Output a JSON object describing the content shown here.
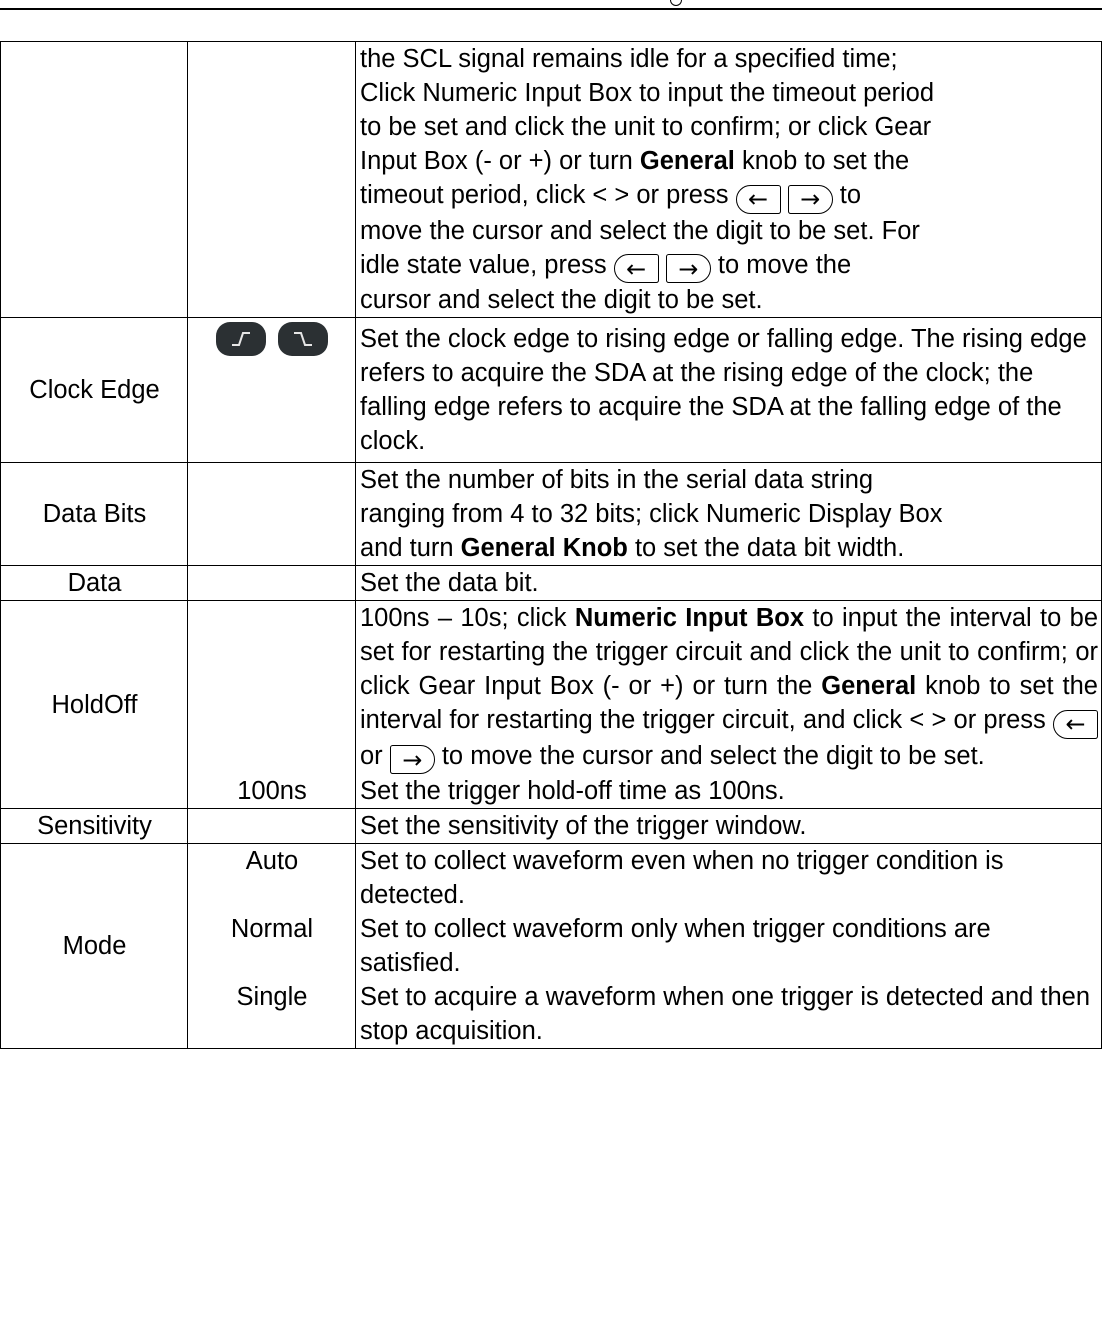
{
  "header": {},
  "rows": {
    "timeout": {
      "lines": [
        "the SCL signal remains idle for a specified time;",
        "Click Numeric Input Box to input the timeout period",
        "to be set and click the unit to confirm; or click Gear"
      ],
      "l4a": "Input Box (- or +) or turn ",
      "l4b": "General",
      "l4c": " knob to set the",
      "l5a": "timeout period, click < > or press ",
      "l5b": " to",
      "l6": "move the cursor and select the digit to be set. For",
      "l7a": "idle state value, press ",
      "l7b": " to move the",
      "l8": "cursor and select the digit to be set."
    },
    "clock_edge": {
      "param": "Clock Edge",
      "icons": [
        "rising-edge-icon",
        "falling-edge-icon"
      ],
      "desc": "Set the clock edge to rising edge or falling edge. The rising edge refers to acquire the SDA at the rising edge of the clock; the falling edge refers to acquire the SDA at the falling edge of the clock."
    },
    "data_bits": {
      "param": "Data Bits",
      "l1": "Set the number of bits in the serial data string",
      "l2": "ranging from 4 to 32 bits; click Numeric Display Box",
      "l3a": "and turn ",
      "l3b": "General Knob",
      "l3c": " to set the data bit width."
    },
    "data": {
      "param": "Data",
      "desc": "Set the data bit."
    },
    "holdoff": {
      "param": "HoldOff",
      "a1": "100ns – 10s; click ",
      "a2": "Numeric Input Box",
      "a3": " to input the interval to be set for restarting the trigger circuit and click the unit to confirm; or click Gear Input Box (- or +) or turn the ",
      "a4": "General",
      "a5": " knob to set the interval for restarting the trigger circuit, and click < > or press ",
      "a6": " or ",
      "a7": " to move the cursor and select the digit to be set.",
      "opt": "100ns",
      "opt_desc": "Set the trigger hold-off time as 100ns."
    },
    "sensitivity": {
      "param": "Sensitivity",
      "desc": "Set the sensitivity of the trigger window."
    },
    "mode": {
      "param": "Mode",
      "auto": "Auto",
      "auto_desc": "Set to collect waveform even when no trigger condition is detected.",
      "normal": "Normal",
      "normal_desc": "Set to collect waveform only when trigger conditions are satisfied.",
      "single": "Single",
      "single_desc": "Set to acquire a waveform when one trigger is detected and then stop acquisition."
    }
  },
  "keys": {
    "left": "←",
    "right": "→"
  }
}
